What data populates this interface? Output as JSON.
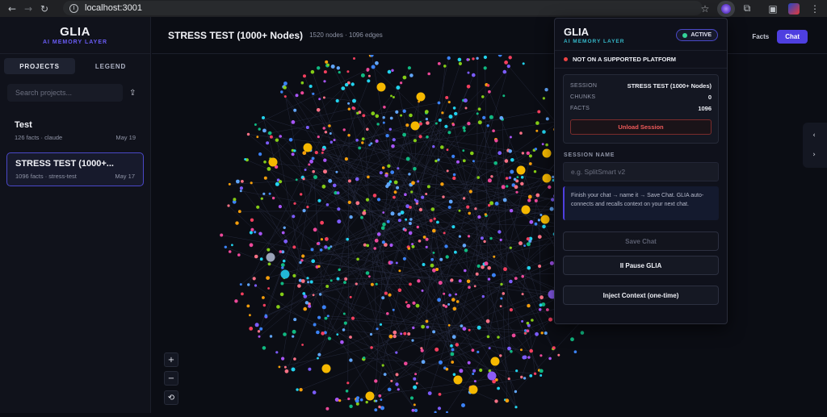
{
  "browser": {
    "url": "localhost:3001",
    "back_icon": "←",
    "forward_icon": "→",
    "reload_icon": "↻",
    "info_icon": "i",
    "star_icon": "☆",
    "extensions_icon": "⧉",
    "cast_icon": "▣",
    "menu_icon": "⋮"
  },
  "sidebar": {
    "brand_title": "GLIA",
    "brand_subtitle": "AI MEMORY LAYER",
    "tabs": [
      "PROJECTS",
      "LEGEND"
    ],
    "search_placeholder": "Search projects...",
    "upload_icon": "⇪",
    "projects": [
      {
        "name": "Test",
        "meta": "126 facts · claude",
        "date": "May 19"
      },
      {
        "name": "STRESS TEST (1000+...",
        "meta": "1096 facts · stress-test",
        "date": "May 17"
      }
    ]
  },
  "main": {
    "title": "STRESS TEST (1000+ Nodes)",
    "meta": "1520 nodes · 1096 edges",
    "view_tabs": [
      "Facts",
      "Chat"
    ],
    "zoom_in": "+",
    "zoom_out": "−",
    "reset": "⟲",
    "arrow_left": "‹",
    "arrow_right": "›"
  },
  "popup": {
    "title": "GLIA",
    "subtitle": "AI MEMORY LAYER",
    "status_badge": "ACTIVE",
    "platform_warning": "NOT ON A SUPPORTED PLATFORM",
    "session": {
      "session_label": "SESSION",
      "session_value": "STRESS TEST (1000+ Nodes)",
      "chunks_label": "CHUNKS",
      "chunks_value": "0",
      "facts_label": "FACTS",
      "facts_value": "1096",
      "unload_label": "Unload Session"
    },
    "session_name_label": "SESSION NAME",
    "session_name_placeholder": "e.g. SplitSmart v2",
    "hint": "Finish your chat → name it → Save Chat. GLIA auto-connects and recalls context on your next chat.",
    "save_chat": "Save Chat",
    "pause": "II  Pause GLIA",
    "inject": "Inject Context (one-time)"
  },
  "colors": {
    "accent": "#4e3fe0",
    "active_dot": "#34d399",
    "warn_dot": "#ef4444",
    "node_palette": [
      "#7c5cff",
      "#3b82f6",
      "#ec4899",
      "#10b981",
      "#f59e0b",
      "#22d3ee",
      "#a855f7",
      "#f43f5e",
      "#84cc16",
      "#fb7185",
      "#60a5fa"
    ]
  }
}
